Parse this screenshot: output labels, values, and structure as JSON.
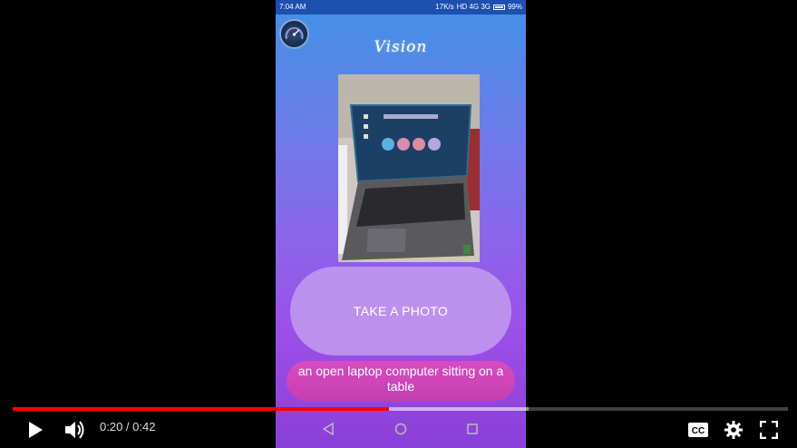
{
  "status_bar": {
    "time": "7:04 AM",
    "network": "17K/s",
    "signal_labels": "HD 4G 3G",
    "battery": "99%"
  },
  "app": {
    "title": "Vision",
    "button_label": "TAKE A PHOTO",
    "caption": "an open laptop computer sitting on a table"
  },
  "player": {
    "current_time": "0:20",
    "duration": "0:42",
    "time_display": "0:20 / 0:42",
    "progress": 0.485,
    "buffered": 0.665
  },
  "colors": {
    "progress_played": "#ff0000",
    "caption_bg": "#d84cc0",
    "statusbar_bg": "#1c4fb0"
  },
  "icons": [
    "play-icon",
    "volume-icon",
    "cc-icon",
    "settings-icon",
    "fullscreen-icon",
    "back-nav-icon",
    "home-nav-icon",
    "recents-nav-icon",
    "speedometer-icon"
  ]
}
